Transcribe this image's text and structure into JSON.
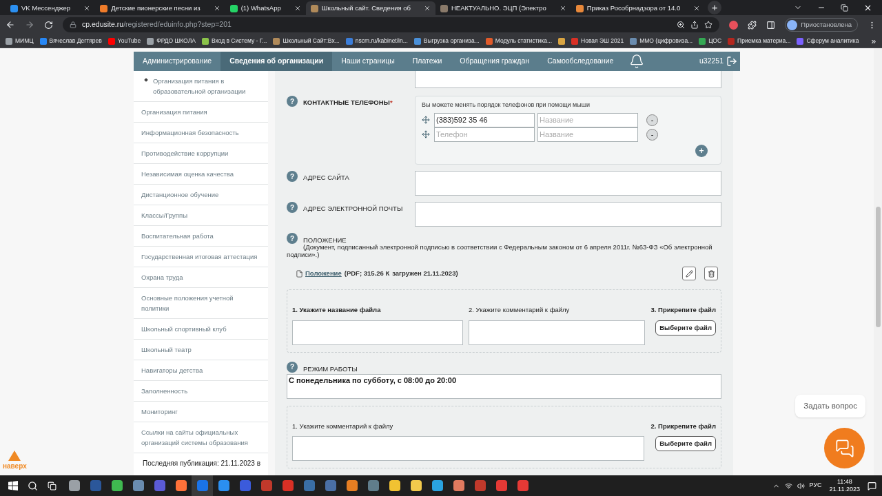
{
  "browser": {
    "tabs": [
      {
        "title": "VK Мессенджер",
        "selected": false,
        "color": "#2b8ff0"
      },
      {
        "title": "Детские пионерские песни из",
        "selected": false,
        "color": "#f07c2a"
      },
      {
        "title": "(1) WhatsApp",
        "selected": false,
        "color": "#25d366"
      },
      {
        "title": "Школьный сайт. Сведения об",
        "selected": true,
        "color": "#b08a5a"
      },
      {
        "title": "НЕАКТУАЛЬНО. ЭЦП (Электро",
        "selected": false,
        "color": "#8a7a6a"
      },
      {
        "title": "Приказ Рособрнадзора от 14.0",
        "selected": false,
        "color": "#e8883a"
      }
    ],
    "new_tab": "+",
    "url": {
      "host": "cp.edusite.ru",
      "path": "/registered/eduinfo.php?step=201"
    },
    "profile": "Приостановлена",
    "bookmarks": [
      {
        "label": "МИМЦ",
        "color": "#9aa0a6"
      },
      {
        "label": "Вячеслав Дегтярев",
        "color": "#2787f5"
      },
      {
        "label": "YouTube",
        "color": "#ff0000"
      },
      {
        "label": "ФРДО ШКОЛА",
        "color": "#9aa0a6"
      },
      {
        "label": "Вход в Систему - Г...",
        "color": "#8bc34a"
      },
      {
        "label": "Школьный Сайт:Вх...",
        "color": "#b08a5a"
      },
      {
        "label": "nscm.ru/kabinet/in...",
        "color": "#3b7dd8"
      },
      {
        "label": "Выгрузка организа...",
        "color": "#4a90d9"
      },
      {
        "label": "Модуль статистика...",
        "color": "#e05a2a"
      },
      {
        "color": "#d9a441"
      },
      {
        "label": "Новая ЭШ 2021",
        "color": "#d93025"
      },
      {
        "label": "ММО (цифровиза...",
        "color": "#6a8caf"
      },
      {
        "label": "ЦОС",
        "color": "#34a853"
      },
      {
        "label": "Приемка материа...",
        "color": "#b3261e"
      },
      {
        "label": "Сферум аналитика",
        "color": "#7b61ff"
      }
    ],
    "more": "»"
  },
  "nav": {
    "items": [
      {
        "label": "Администрирование",
        "selected": false
      },
      {
        "label": "Сведения об организации",
        "selected": true
      },
      {
        "label": "Наши страницы",
        "selected": false
      },
      {
        "label": "Платежи",
        "selected": false
      },
      {
        "label": "Обращения граждан",
        "selected": false
      },
      {
        "label": "Самообследование",
        "selected": false
      }
    ],
    "user": "u32251"
  },
  "sidebar": {
    "items": [
      {
        "label": "Организация питания в образовательной организации",
        "kind": "subitem"
      },
      {
        "label": "Организация питания",
        "kind": "item"
      },
      {
        "label": "Информационная безопасность",
        "kind": "item"
      },
      {
        "label": "Противодействие коррупции",
        "kind": "item"
      },
      {
        "label": "Независимая оценка качества",
        "kind": "item"
      },
      {
        "label": "Дистанционное обучение",
        "kind": "item"
      },
      {
        "label": "Классы/Группы",
        "kind": "item"
      },
      {
        "label": "Воспитательная работа",
        "kind": "item"
      },
      {
        "label": "Государственная итоговая аттестация",
        "kind": "item"
      },
      {
        "label": "Охрана труда",
        "kind": "item"
      },
      {
        "label": "Основные положения учетной политики",
        "kind": "item"
      },
      {
        "label": "Школьный спортивный клуб",
        "kind": "item"
      },
      {
        "label": "Школьный театр",
        "kind": "item"
      },
      {
        "label": "Навигаторы детства",
        "kind": "item"
      },
      {
        "label": "Заполненность",
        "kind": "item"
      },
      {
        "label": "Мониторинг",
        "kind": "item"
      },
      {
        "label": "Ссылки на сайты официальных организаций системы образования",
        "kind": "item"
      }
    ],
    "footer": "Последняя публикация: 21.11.2023 в"
  },
  "form": {
    "phones": {
      "help": "?",
      "label": "КОНТАКТНЫЕ ТЕЛЕФОНЫ",
      "required_mark": "*",
      "hint": "Вы можете менять порядок телефонов при помощи мыши",
      "rows": [
        {
          "value": "(383)592 35 46",
          "name_placeholder": "Название",
          "remove": "-"
        },
        {
          "placeholder": "Телефон",
          "name_placeholder": "Название",
          "remove": "-"
        }
      ],
      "add": "+"
    },
    "site": {
      "help": "?",
      "label": "АДРЕС САЙТА"
    },
    "email": {
      "help": "?",
      "label": "АДРЕС ЭЛЕКТРОННОЙ ПОЧТЫ"
    },
    "document": {
      "help": "?",
      "label": "ПОЛОЖЕНИЕ",
      "note": "(Документ, подписанный электронной подписью в соответствии с Федеральным законом от 6 апреля 2011г. №63-ФЗ «Об электронной подписи».)",
      "file": {
        "link": "Положение",
        "meta_before": "(PDF; 315.26 К",
        "meta_after": "загружен 21.11.2023)"
      },
      "upload": {
        "steps": [
          {
            "kind": "text",
            "label": "1. Укажите название файла",
            "bold": true
          },
          {
            "kind": "text",
            "label": "2. Укажите комментарий к файлу",
            "bold": false
          },
          {
            "kind": "file",
            "label": "3. Прикрепите файл",
            "bold": true,
            "button": "Выберите файл"
          }
        ]
      }
    },
    "schedule": {
      "help": "?",
      "label": "РЕЖИМ РАБОТЫ",
      "value": "С понедельника по субботу, с 08:00 до 20:00",
      "upload": {
        "steps": [
          {
            "kind": "text",
            "label": "1. Укажите комментарий к файлу",
            "bold": false
          },
          {
            "kind": "file",
            "label": "2. Прикрепите файл",
            "bold": true,
            "button": "Выберите файл"
          }
        ]
      }
    }
  },
  "widgets": {
    "to_top": "наверх",
    "chat": "Задать вопрос"
  },
  "taskbar": {
    "lang": "РУС",
    "time": "11:48",
    "date": "21.11.2023"
  }
}
